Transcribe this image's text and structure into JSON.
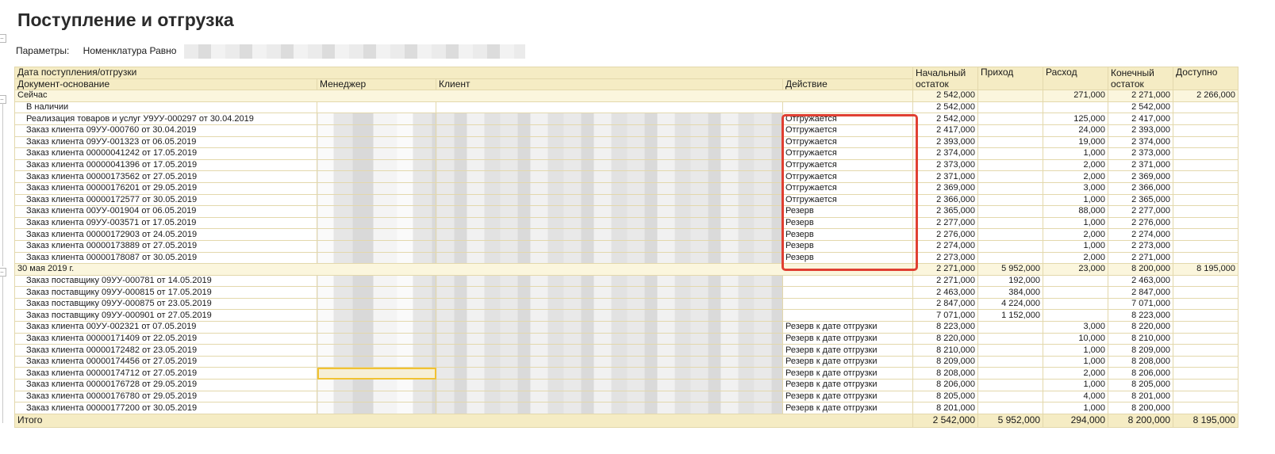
{
  "title": "Поступление и отгрузка",
  "params": {
    "label": "Параметры:",
    "value": "Номенклатура Равно"
  },
  "headers": {
    "date": "Дата поступления/отгрузки",
    "doc": "Документ-основание",
    "manager": "Менеджер",
    "client": "Клиент",
    "action": "Действие",
    "start": "Начальный остаток",
    "income": "Приход",
    "expense": "Расход",
    "end": "Конечный остаток",
    "available": "Доступно"
  },
  "rows": [
    {
      "type": "group",
      "doc": "Сейчас",
      "action": "",
      "start": "2 542,000",
      "income": "",
      "expense": "271,000",
      "end": "2 271,000",
      "available": "2 266,000"
    },
    {
      "type": "sub",
      "doc": "В наличии",
      "action": "",
      "start": "2 542,000",
      "income": "",
      "expense": "",
      "end": "2 542,000",
      "available": ""
    },
    {
      "type": "row",
      "doc": "Реализация товаров и услуг У9УУ-000297 от 30.04.2019",
      "action": "Отгружается",
      "start": "2 542,000",
      "income": "",
      "expense": "125,000",
      "end": "2 417,000",
      "available": ""
    },
    {
      "type": "row",
      "doc": "Заказ клиента 09УУ-000760 от 30.04.2019",
      "action": "Отгружается",
      "start": "2 417,000",
      "income": "",
      "expense": "24,000",
      "end": "2 393,000",
      "available": ""
    },
    {
      "type": "row",
      "doc": "Заказ клиента 09УУ-001323 от 06.05.2019",
      "action": "Отгружается",
      "start": "2 393,000",
      "income": "",
      "expense": "19,000",
      "end": "2 374,000",
      "available": ""
    },
    {
      "type": "row",
      "doc": "Заказ клиента 00000041242 от 17.05.2019",
      "action": "Отгружается",
      "start": "2 374,000",
      "income": "",
      "expense": "1,000",
      "end": "2 373,000",
      "available": ""
    },
    {
      "type": "row",
      "doc": "Заказ клиента 00000041396 от 17.05.2019",
      "action": "Отгружается",
      "start": "2 373,000",
      "income": "",
      "expense": "2,000",
      "end": "2 371,000",
      "available": ""
    },
    {
      "type": "row",
      "doc": "Заказ клиента 00000173562 от 27.05.2019",
      "action": "Отгружается",
      "start": "2 371,000",
      "income": "",
      "expense": "2,000",
      "end": "2 369,000",
      "available": ""
    },
    {
      "type": "row",
      "doc": "Заказ клиента 00000176201 от 29.05.2019",
      "action": "Отгружается",
      "start": "2 369,000",
      "income": "",
      "expense": "3,000",
      "end": "2 366,000",
      "available": ""
    },
    {
      "type": "row",
      "doc": "Заказ клиента 00000172577 от 30.05.2019",
      "action": "Отгружается",
      "start": "2 366,000",
      "income": "",
      "expense": "1,000",
      "end": "2 365,000",
      "available": ""
    },
    {
      "type": "row",
      "doc": "Заказ клиента 00УУ-001904 от 06.05.2019",
      "action": "Резерв",
      "start": "2 365,000",
      "income": "",
      "expense": "88,000",
      "end": "2 277,000",
      "available": ""
    },
    {
      "type": "row",
      "doc": "Заказ клиента 09УУ-003571 от 17.05.2019",
      "action": "Резерв",
      "start": "2 277,000",
      "income": "",
      "expense": "1,000",
      "end": "2 276,000",
      "available": ""
    },
    {
      "type": "row",
      "doc": "Заказ клиента 00000172903 от 24.05.2019",
      "action": "Резерв",
      "start": "2 276,000",
      "income": "",
      "expense": "2,000",
      "end": "2 274,000",
      "available": ""
    },
    {
      "type": "row",
      "doc": "Заказ клиента 00000173889 от 27.05.2019",
      "action": "Резерв",
      "start": "2 274,000",
      "income": "",
      "expense": "1,000",
      "end": "2 273,000",
      "available": ""
    },
    {
      "type": "row",
      "doc": "Заказ клиента 00000178087 от 30.05.2019",
      "action": "Резерв",
      "start": "2 273,000",
      "income": "",
      "expense": "2,000",
      "end": "2 271,000",
      "available": ""
    },
    {
      "type": "group",
      "doc": "30 мая 2019 г.",
      "action": "",
      "start": "2 271,000",
      "income": "5 952,000",
      "expense": "23,000",
      "end": "8 200,000",
      "available": "8 195,000"
    },
    {
      "type": "row",
      "doc": "Заказ поставщику 09УУ-000781 от 14.05.2019",
      "action": "",
      "start": "2 271,000",
      "income": "192,000",
      "expense": "",
      "end": "2 463,000",
      "available": ""
    },
    {
      "type": "row",
      "doc": "Заказ поставщику 09УУ-000815 от 17.05.2019",
      "action": "",
      "start": "2 463,000",
      "income": "384,000",
      "expense": "",
      "end": "2 847,000",
      "available": ""
    },
    {
      "type": "row",
      "doc": "Заказ поставщику 09УУ-000875 от 23.05.2019",
      "action": "",
      "start": "2 847,000",
      "income": "4 224,000",
      "expense": "",
      "end": "7 071,000",
      "available": ""
    },
    {
      "type": "row",
      "doc": "Заказ поставщику 09УУ-000901 от 27.05.2019",
      "action": "",
      "start": "7 071,000",
      "income": "1 152,000",
      "expense": "",
      "end": "8 223,000",
      "available": ""
    },
    {
      "type": "row",
      "doc": "Заказ клиента 00УУ-002321 от 07.05.2019",
      "action": "Резерв к дате отгрузки",
      "start": "8 223,000",
      "income": "",
      "expense": "3,000",
      "end": "8 220,000",
      "available": ""
    },
    {
      "type": "row",
      "doc": "Заказ клиента 00000171409 от 22.05.2019",
      "action": "Резерв к дате отгрузки",
      "start": "8 220,000",
      "income": "",
      "expense": "10,000",
      "end": "8 210,000",
      "available": ""
    },
    {
      "type": "row",
      "doc": "Заказ клиента 00000172482 от 23.05.2019",
      "action": "Резерв к дате отгрузки",
      "start": "8 210,000",
      "income": "",
      "expense": "1,000",
      "end": "8 209,000",
      "available": ""
    },
    {
      "type": "row",
      "doc": "Заказ клиента 00000174456 от 27.05.2019",
      "action": "Резерв к дате отгрузки",
      "start": "8 209,000",
      "income": "",
      "expense": "1,000",
      "end": "8 208,000",
      "available": ""
    },
    {
      "type": "row",
      "doc": "Заказ клиента 00000174712 от 27.05.2019",
      "action": "Резерв к дате отгрузки",
      "start": "8 208,000",
      "income": "",
      "expense": "2,000",
      "end": "8 206,000",
      "available": "",
      "selected": true
    },
    {
      "type": "row",
      "doc": "Заказ клиента 00000176728 от 29.05.2019",
      "action": "Резерв к дате отгрузки",
      "start": "8 206,000",
      "income": "",
      "expense": "1,000",
      "end": "8 205,000",
      "available": ""
    },
    {
      "type": "row",
      "doc": "Заказ клиента 00000176780 от 29.05.2019",
      "action": "Резерв к дате отгрузки",
      "start": "8 205,000",
      "income": "",
      "expense": "4,000",
      "end": "8 201,000",
      "available": ""
    },
    {
      "type": "row",
      "doc": "Заказ клиента 00000177200 от 30.05.2019",
      "action": "Резерв к дате отгрузки",
      "start": "8 201,000",
      "income": "",
      "expense": "1,000",
      "end": "8 200,000",
      "available": ""
    }
  ],
  "total": {
    "label": "Итого",
    "start": "2 542,000",
    "income": "5 952,000",
    "expense": "294,000",
    "end": "8 200,000",
    "available": "8 195,000"
  },
  "colors": {
    "header_bg": "#f5ecc4",
    "highlight_border": "#e04032",
    "selection": "#f1c232"
  }
}
